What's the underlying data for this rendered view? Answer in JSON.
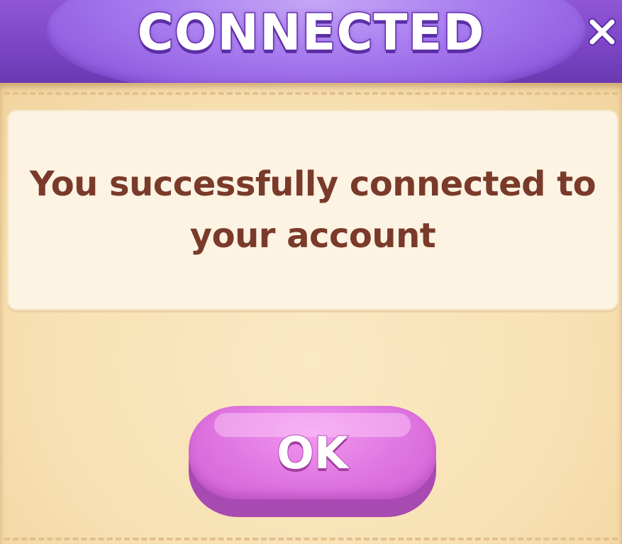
{
  "dialog": {
    "title": "CONNECTED",
    "message": "You successfully connected to your account",
    "ok_label": "OK",
    "close_icon": "close-icon"
  },
  "colors": {
    "header_purple": "#7a44c4",
    "title_dome": "#aa7ff0",
    "panel_beige": "#f8e2b5",
    "message_box": "#fcf3e3",
    "message_text": "#7a3a2a",
    "ok_button_pink": "#e27ae3"
  }
}
